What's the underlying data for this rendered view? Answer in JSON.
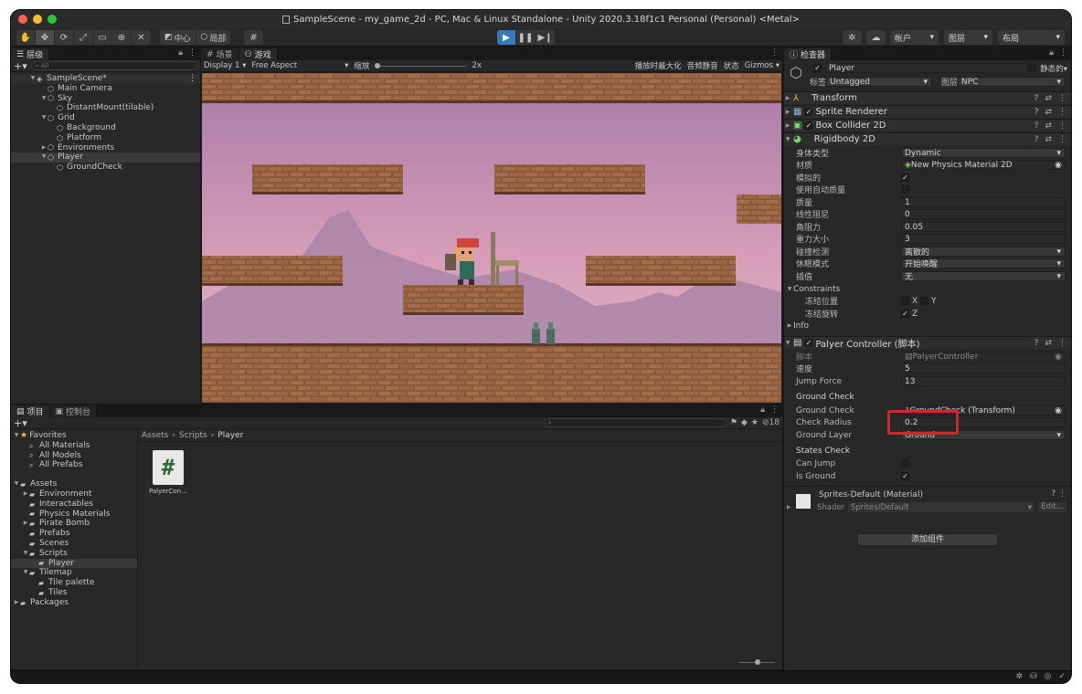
{
  "window": {
    "title": "SampleScene - my_game_2d - PC, Mac & Linux Standalone - Unity 2020.3.18f1c1 Personal (Personal) <Metal>"
  },
  "toolbar": {
    "pivot_label": "中心",
    "space_label": "局部",
    "account_label": "帐户",
    "layers_label": "图层",
    "layout_label": "布局"
  },
  "hierarchy": {
    "tab_label": "层级",
    "search_placeholder": "All",
    "items": [
      {
        "label": "SampleScene*",
        "depth": 0
      },
      {
        "label": "Main Camera",
        "depth": 1
      },
      {
        "label": "Sky",
        "depth": 1
      },
      {
        "label": "DistantMount(tilable)",
        "depth": 2
      },
      {
        "label": "Grid",
        "depth": 1
      },
      {
        "label": "Background",
        "depth": 2
      },
      {
        "label": "Platform",
        "depth": 2
      },
      {
        "label": "Environments",
        "depth": 1
      },
      {
        "label": "Player",
        "depth": 1
      },
      {
        "label": "GroundCheck",
        "depth": 2
      }
    ]
  },
  "game": {
    "scene_tab": "场景",
    "game_tab": "游戏",
    "display": "Display 1",
    "aspect": "Free Aspect",
    "scale_label": "缩放",
    "scale_value": "2x",
    "maximize_label": "播放时最大化",
    "mute_label": "音频静音",
    "stats_label": "状态",
    "gizmos_label": "Gizmos"
  },
  "project": {
    "project_tab": "项目",
    "console_tab": "控制台",
    "hidden_count": "18",
    "favorites_label": "Favorites",
    "favorites": [
      "All Materials",
      "All Models",
      "All Prefabs"
    ],
    "assets_label": "Assets",
    "folders": [
      {
        "label": "Environment",
        "depth": 1
      },
      {
        "label": "Interactables",
        "depth": 1
      },
      {
        "label": "Physics Materials",
        "depth": 1
      },
      {
        "label": "Pirate Bomb",
        "depth": 1
      },
      {
        "label": "Prefabs",
        "depth": 1
      },
      {
        "label": "Scenes",
        "depth": 1
      },
      {
        "label": "Scripts",
        "depth": 1
      },
      {
        "label": "Player",
        "depth": 2
      },
      {
        "label": "Tilemap",
        "depth": 1
      },
      {
        "label": "Tile palette",
        "depth": 2
      },
      {
        "label": "Tiles",
        "depth": 2
      }
    ],
    "packages_label": "Packages",
    "breadcrumb": [
      "Assets",
      "Scripts",
      "Player"
    ],
    "asset_file": "PalyerCon…"
  },
  "inspector": {
    "tab_label": "检查器",
    "object_name": "Player",
    "static_label": "静态的",
    "tag_label": "标签",
    "tag_value": "Untagged",
    "layer_label": "图层",
    "layer_value": "NPC",
    "components": {
      "transform": "Transform",
      "sprite_renderer": "Sprite Renderer",
      "box_collider": "Box Collider 2D",
      "rigidbody": "Rigidbody 2D",
      "player_controller": "Palyer Controller  (脚本)"
    },
    "rigidbody": {
      "body_type_label": "身体类型",
      "body_type": "Dynamic",
      "material_label": "材质",
      "material": "New Physics Material 2D",
      "simulated_label": "模拟的",
      "auto_mass_label": "使用自动质量",
      "mass_label": "质量",
      "mass": "1",
      "linear_drag_label": "线性阻尼",
      "linear_drag": "0",
      "angular_drag_label": "角阻力",
      "angular_drag": "0.05",
      "gravity_label": "重力大小",
      "gravity": "3",
      "collision_label": "碰撞检测",
      "collision": "离散的",
      "sleep_label": "休眠模式",
      "sleep": "开始唤醒",
      "interp_label": "插值",
      "interp": "无",
      "constraints_label": "Constraints",
      "freeze_pos_label": "冻结位置",
      "freeze_rot_label": "冻结旋转",
      "axis_x": "X",
      "axis_y": "Y",
      "axis_z": "Z",
      "info_label": "Info"
    },
    "controller": {
      "script_label": "脚本",
      "script": "PalyerController",
      "speed_label": "速度",
      "speed": "5",
      "jump_label": "Jump Force",
      "jump": "13",
      "ground_section": "Ground Check",
      "ground_check_label": "Ground Check",
      "ground_check": "GroundCheck (Transform)",
      "radius_label": "Check Radius",
      "radius": "0.2",
      "ground_layer_label": "Ground Layer",
      "ground_layer": "Ground",
      "states_section": "States Check",
      "can_jump_label": "Can Jump",
      "is_ground_label": "Is Ground"
    },
    "material": {
      "name": "Sprites-Default (Material)",
      "shader_label": "Shader",
      "shader": "Sprites/Default",
      "edit_label": "Edit..."
    },
    "add_component": "添加组件"
  },
  "colors": {
    "accent": "#3a79bb",
    "highlight_box": "#c42d2a",
    "sky_top": "#a77aa8",
    "sky_bottom": "#e9b4bf",
    "brick": "#8a5a3c"
  }
}
